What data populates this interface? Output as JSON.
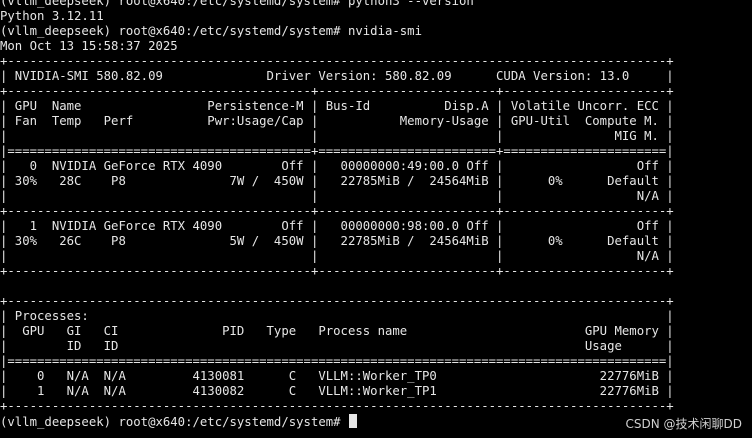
{
  "theme": {
    "background": "#000000",
    "foreground": "#e6e6e6"
  },
  "terminal": {
    "lines": [
      "(vllm_deepseek) root@x640:/etc/systemd/system# python3 --version",
      "Python 3.12.11",
      "(vllm_deepseek) root@x640:/etc/systemd/system# nvidia-smi",
      "Mon Oct 13 15:58:37 2025",
      "+-----------------------------------------------------------------------------------------+",
      "| NVIDIA-SMI 580.82.09              Driver Version: 580.82.09      CUDA Version: 13.0     |",
      "+-----------------------------------------+------------------------+----------------------+",
      "| GPU  Name                 Persistence-M | Bus-Id          Disp.A | Volatile Uncorr. ECC |",
      "| Fan  Temp   Perf          Pwr:Usage/Cap |           Memory-Usage | GPU-Util  Compute M. |",
      "|                                         |                        |               MIG M. |",
      "|=========================================+========================+======================|",
      "|   0  NVIDIA GeForce RTX 4090        Off |   00000000:49:00.0 Off |                  Off |",
      "| 30%   28C    P8              7W /  450W |   22785MiB /  24564MiB |      0%      Default |",
      "|                                         |                        |                  N/A |",
      "+-----------------------------------------+------------------------+----------------------+",
      "|   1  NVIDIA GeForce RTX 4090        Off |   00000000:98:00.0 Off |                  Off |",
      "| 30%   26C    P8              5W /  450W |   22785MiB /  24564MiB |      0%      Default |",
      "|                                         |                        |                  N/A |",
      "+-----------------------------------------+------------------------+----------------------+",
      "",
      "+-----------------------------------------------------------------------------------------+",
      "| Processes:                                                                              |",
      "|  GPU   GI   CI              PID   Type   Process name                        GPU Memory |",
      "|        ID   ID                                                               Usage      |",
      "|=========================================================================================|",
      "|    0   N/A  N/A         4130081      C   VLLM::Worker_TP0                      22776MiB |",
      "|    1   N/A  N/A         4130082      C   VLLM::Worker_TP1                      22776MiB |",
      "+-----------------------------------------------------------------------------------------+"
    ],
    "prompt": "(vllm_deepseek) root@x640:/etc/systemd/system# "
  },
  "watermark": "CSDN @技术闲聊DD"
}
